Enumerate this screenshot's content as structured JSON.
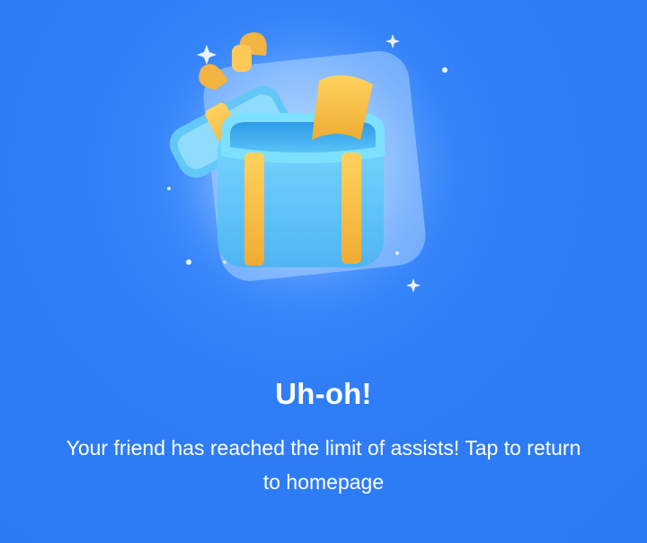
{
  "dialog": {
    "title": "Uh-oh!",
    "message": "Your friend has reached the limit of assists! Tap to return to homepage"
  },
  "illustration": {
    "icon": "open-gift-box-icon"
  },
  "colors": {
    "background": "#2f7df6",
    "box": "#6fd0ff",
    "ribbon": "#f6c04b",
    "text": "#ffffff"
  }
}
